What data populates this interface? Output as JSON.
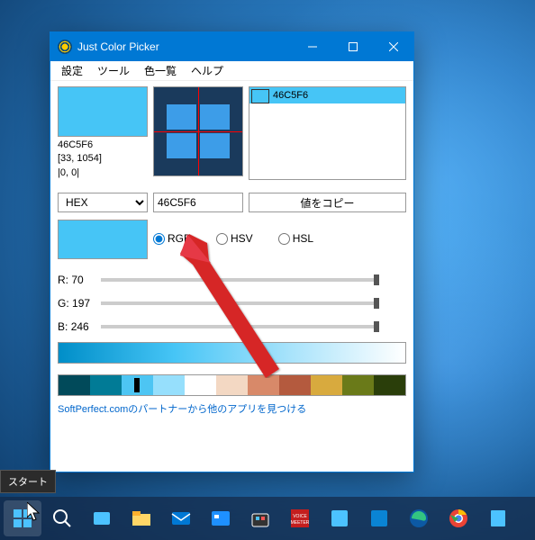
{
  "window": {
    "title": "Just Color Picker"
  },
  "menu": [
    "設定",
    "ツール",
    "色一覧",
    "ヘルプ"
  ],
  "swatch": {
    "hex": "46C5F6",
    "coords": "[33, 1054]",
    "offset": "|0, 0|",
    "color": "#46c5f6"
  },
  "history": [
    {
      "label": "46C5F6",
      "color": "#46c5f6"
    }
  ],
  "format": {
    "selected": "HEX",
    "code": "46C5F6",
    "copy_label": "値をコピー"
  },
  "color_model": {
    "options": [
      "RGB",
      "HSV",
      "HSL"
    ],
    "selected": "RGB"
  },
  "channels": [
    {
      "label": "R:",
      "value": 70
    },
    {
      "label": "G:",
      "value": 197
    },
    {
      "label": "B:",
      "value": 246
    }
  ],
  "palette": [
    "#014a5a",
    "#017b96",
    "#4dc5f3",
    "#96dffc",
    "#ffffff",
    "#f3d8c3",
    "#d88969",
    "#b45a3e",
    "#d8aa3e",
    "#6a7a19",
    "#2a3e0a"
  ],
  "palette_selected_index": 2,
  "footer_link": "SoftPerfect.comのパートナーから他のアプリを見つける",
  "tooltip": "スタート"
}
